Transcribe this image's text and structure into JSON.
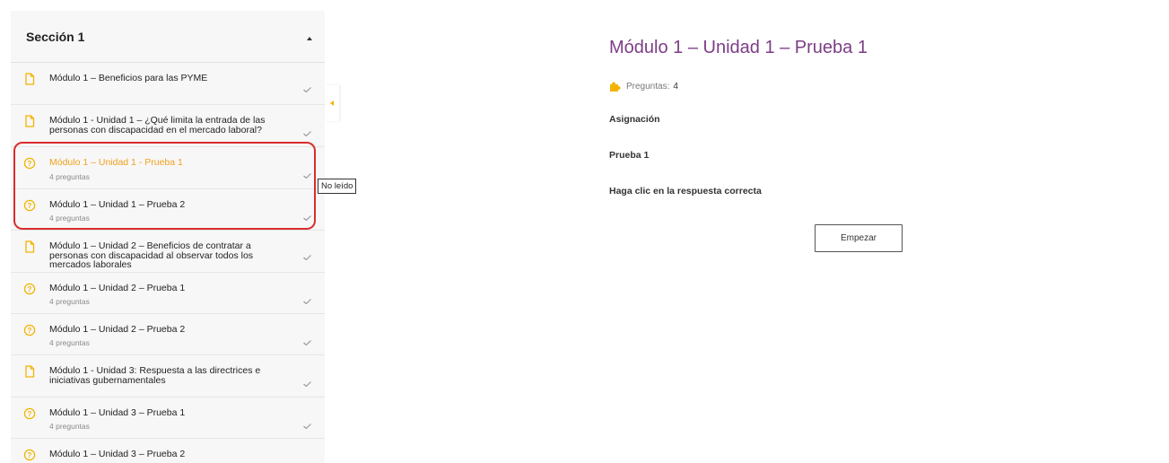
{
  "sidebar": {
    "section_title": "Sección 1",
    "items": [
      {
        "label": "Módulo 1 – Beneficios para las PYME",
        "sub": "",
        "type": "doc",
        "active": false
      },
      {
        "label": "Módulo 1 - Unidad 1 – ¿Qué limita la entrada de las personas con discapacidad en el mercado laboral?",
        "sub": "",
        "type": "doc",
        "active": false
      },
      {
        "label": "Módulo 1 – Unidad 1 - Prueba 1",
        "sub": "4 preguntas",
        "type": "quiz",
        "active": true
      },
      {
        "label": "Módulo 1 – Unidad 1 – Prueba 2",
        "sub": "4 preguntas",
        "type": "quiz",
        "active": false
      },
      {
        "label": "Módulo 1 – Unidad 2 – Beneficios de contratar a personas con discapacidad al observar todos los mercados laborales",
        "sub": "",
        "type": "doc",
        "active": false
      },
      {
        "label": "Módulo 1 – Unidad 2 – Prueba 1",
        "sub": "4 preguntas",
        "type": "quiz",
        "active": false
      },
      {
        "label": "Módulo 1 – Unidad 2 – Prueba 2",
        "sub": "4 preguntas",
        "type": "quiz",
        "active": false
      },
      {
        "label": "Módulo 1 - Unidad 3: Respuesta a las directrices e iniciativas gubernamentales",
        "sub": "",
        "type": "doc",
        "active": false
      },
      {
        "label": "Módulo 1 – Unidad 3 – Prueba 1",
        "sub": "4 preguntas",
        "type": "quiz",
        "active": false
      },
      {
        "label": "Módulo 1 – Unidad 3 – Prueba 2",
        "sub": "",
        "type": "quiz",
        "active": false
      }
    ]
  },
  "tooltip": "No leído",
  "main": {
    "title": "Módulo 1 – Unidad 1 – Prueba 1",
    "questions_label": "Preguntas:",
    "questions_value": "4",
    "heading_assignment": "Asignación",
    "heading_test": "Prueba 1",
    "heading_instruction": "Haga clic en la respuesta correcta",
    "start_button": "Empezar"
  },
  "colors": {
    "title": "#7c3d86",
    "accent": "#f2a11f",
    "highlight_border": "#d92d2d",
    "sidebar_bg": "#f7f7f7"
  }
}
